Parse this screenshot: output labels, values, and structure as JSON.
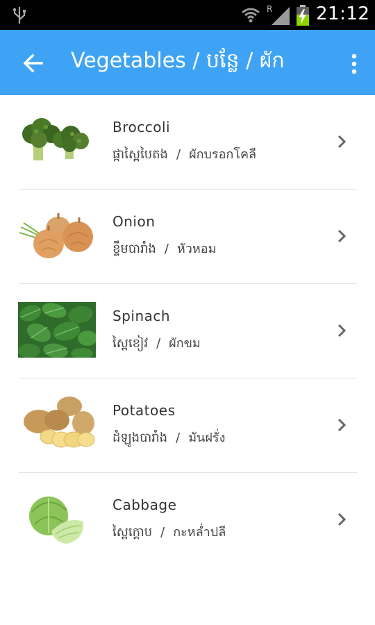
{
  "status_bar": {
    "time": "21:12",
    "signal_label": "R",
    "icons": [
      "usb-icon",
      "wifi-icon",
      "signal-icon",
      "battery-charging-icon"
    ]
  },
  "app_bar": {
    "title": "Vegetables / បន្លែ / ผัก",
    "back_icon": "arrow-left-icon",
    "menu_icon": "more-vert-icon",
    "color": "#3ea3f4"
  },
  "items": [
    {
      "english": "Broccoli",
      "khmer": "ផ្កាស្ពៃបៃតង",
      "separator": "/",
      "thai": "ผักบรอกโคลี",
      "image": "broccoli-image"
    },
    {
      "english": "Onion",
      "khmer": "ខ្ទឹមបារាំង",
      "separator": "/",
      "thai": "หัวหอม",
      "image": "onion-image"
    },
    {
      "english": "Spinach",
      "khmer": "ស្ពៃខៀវ",
      "separator": "/",
      "thai": "ผักขม",
      "image": "spinach-image"
    },
    {
      "english": "Potatoes",
      "khmer": "ដំឡូងបារាំង",
      "separator": "/",
      "thai": "มันฝรั่ง",
      "image": "potatoes-image"
    },
    {
      "english": "Cabbage",
      "khmer": "ស្ពៃក្តោប",
      "separator": "/",
      "thai": "กะหล่ำปลี",
      "image": "cabbage-image"
    }
  ]
}
